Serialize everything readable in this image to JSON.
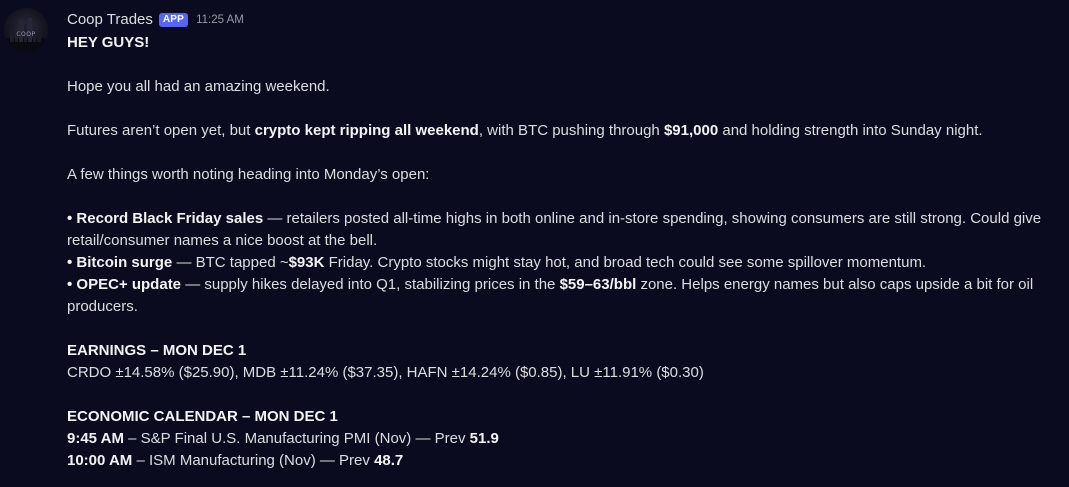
{
  "author": {
    "name": "Coop Trades",
    "badge": "APP",
    "timestamp": "11:25 AM",
    "avatar_text": "COOP"
  },
  "message": {
    "greeting": "HEY GUYS!",
    "line1": "Hope you all had an amazing weekend.",
    "line2": {
      "a": "Futures aren’t open yet, but ",
      "b": "crypto kept ripping all weekend",
      "c": ", with BTC pushing through ",
      "d": "$91,000",
      "e": " and holding strength into Sunday night."
    },
    "line3": "A few things worth noting heading into Monday’s open:",
    "bullets": [
      {
        "prefix": "• ",
        "title": "Record Black Friday sales",
        "text": " — retailers posted all-time highs in both online and in-store spending, showing consumers are still strong. Could give retail/consumer names a nice boost at the bell."
      },
      {
        "prefix": "• ",
        "title": "Bitcoin surge",
        "text_a": " — BTC tapped ~",
        "bold": "$93K",
        "text_b": " Friday. Crypto stocks might stay hot, and broad tech could see some spillover momentum."
      },
      {
        "prefix": "• ",
        "title": "OPEC+ update",
        "text_a": " — supply hikes delayed into Q1, stabilizing prices in the ",
        "bold": "$59–63/bbl",
        "text_b": " zone. Helps energy names but also caps upside a bit for oil producers."
      }
    ],
    "earnings_heading": "EARNINGS – MON DEC 1",
    "earnings_line": "CRDO ±14.58% ($25.90), MDB ±11.24% ($37.35), HAFN ±14.24% ($0.85), LU ±11.91% ($0.30)",
    "calendar_heading": "ECONOMIC CALENDAR – MON DEC 1",
    "calendar": [
      {
        "time": "9:45 AM",
        "text": " – S&P Final U.S. Manufacturing PMI (Nov) — Prev ",
        "prev": "51.9"
      },
      {
        "time": "10:00 AM",
        "text": " – ISM Manufacturing (Nov) — Prev ",
        "prev": "48.7"
      }
    ]
  },
  "colors": {
    "background": "#0b0b1f",
    "text": "#dbdee1",
    "badge": "#5865f2",
    "timestamp": "#949ba4"
  }
}
